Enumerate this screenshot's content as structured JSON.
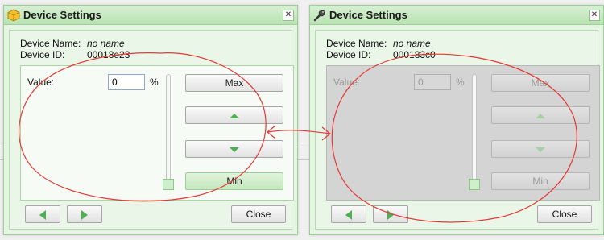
{
  "colors": {
    "titlebar": "#b8e2b0",
    "dialog_bg": "#e6f4e4",
    "accent_arrow": "#4caf50",
    "annotation": "#e53935",
    "disabled_bg": "#d4d4d4"
  },
  "dialogs": [
    {
      "title": "Device Settings",
      "title_icon": "cube-icon",
      "close_glyph": "✕",
      "device_name_label": "Device Name:",
      "device_name_value": "no name",
      "device_id_label": "Device ID:",
      "device_id_value": "00018e23",
      "value_label": "Value:",
      "value": "0",
      "unit": "%",
      "slider_level": 0,
      "max_label": "Max",
      "up_icon": "arrow-up-icon",
      "down_icon": "arrow-down-icon",
      "min_label": "Min",
      "prev_icon": "arrow-left-icon",
      "next_icon": "arrow-right-icon",
      "close_label": "Close",
      "enabled": true
    },
    {
      "title": "Device Settings",
      "title_icon": "tool-icon",
      "close_glyph": "✕",
      "device_name_label": "Device Name:",
      "device_name_value": "no name",
      "device_id_label": "Device ID:",
      "device_id_value": "000183c0",
      "value_label": "Value:",
      "value": "0",
      "unit": "%",
      "slider_level": 0,
      "max_label": "Max",
      "up_icon": "arrow-up-icon",
      "down_icon": "arrow-down-icon",
      "min_label": "Min",
      "prev_icon": "arrow-left-icon",
      "next_icon": "arrow-right-icon",
      "close_label": "Close",
      "enabled": false
    }
  ]
}
